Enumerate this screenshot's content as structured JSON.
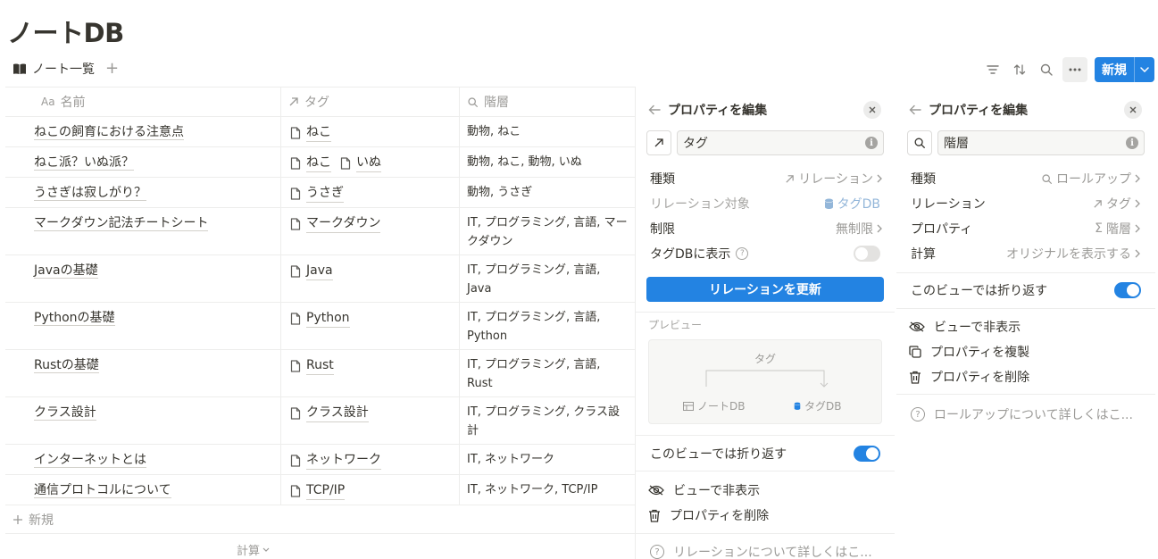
{
  "page": {
    "title": "ノートDB"
  },
  "view": {
    "tab_label": "ノート一覧",
    "add": "+"
  },
  "toolbar": {
    "new_label": "新規"
  },
  "table": {
    "headers": {
      "name": "名前",
      "name_prefix": "Aa",
      "tag": "タグ",
      "level": "階層"
    },
    "rows": [
      {
        "name": "ねこの飼育における注意点",
        "tags": [
          "ねこ"
        ],
        "level": "動物, ねこ"
      },
      {
        "name": "ねこ派？いぬ派？",
        "tags": [
          "ねこ",
          "いぬ"
        ],
        "level": "動物, ねこ, 動物, いぬ"
      },
      {
        "name": "うさぎは寂しがり？",
        "tags": [
          "うさぎ"
        ],
        "level": "動物, うさぎ"
      },
      {
        "name": "マークダウン記法チートシート",
        "tags": [
          "マークダウン"
        ],
        "level": "IT, プログラミング, 言語, マークダウン"
      },
      {
        "name": "Javaの基礎",
        "tags": [
          "Java"
        ],
        "level": "IT, プログラミング, 言語, Java"
      },
      {
        "name": "Pythonの基礎",
        "tags": [
          "Python"
        ],
        "level": "IT, プログラミング, 言語, Python"
      },
      {
        "name": "Rustの基礎",
        "tags": [
          "Rust"
        ],
        "level": "IT, プログラミング, 言語, Rust"
      },
      {
        "name": "クラス設計",
        "tags": [
          "クラス設計"
        ],
        "level": "IT, プログラミング, クラス設計"
      },
      {
        "name": "インターネットとは",
        "tags": [
          "ネットワーク"
        ],
        "level": "IT, ネットワーク"
      },
      {
        "name": "通信プロトコルについて",
        "tags": [
          "TCP/IP"
        ],
        "level": "IT, ネットワーク, TCP/IP"
      }
    ],
    "new_row": "新規",
    "calculate": "計算"
  },
  "panel1": {
    "title": "プロパティを編集",
    "name_value": "タグ",
    "type_label": "種類",
    "type_value": "リレーション",
    "target_label": "リレーション対象",
    "target_value": "タグDB",
    "limit_label": "制限",
    "limit_value": "無制限",
    "show_label": "タグDBに表示",
    "show_on": false,
    "update_button": "リレーションを更新",
    "preview_label": "プレビュー",
    "preview_tag": "タグ",
    "preview_from": "ノートDB",
    "preview_to": "タグDB",
    "wrap_label": "このビューでは折り返す",
    "wrap_on": true,
    "hide_label": "ビューで非表示",
    "delete_label": "プロパティを削除",
    "learn_label": "リレーションについて詳しくはこ..."
  },
  "panel2": {
    "title": "プロパティを編集",
    "name_value": "階層",
    "type_label": "種類",
    "type_value": "ロールアップ",
    "relation_label": "リレーション",
    "relation_value": "タグ",
    "property_label": "プロパティ",
    "property_value": "階層",
    "calc_label": "計算",
    "calc_value": "オリジナルを表示する",
    "wrap_label": "このビューでは折り返す",
    "wrap_on": true,
    "hide_label": "ビューで非表示",
    "duplicate_label": "プロパティを複製",
    "delete_label": "プロパティを削除",
    "learn_label": "ロールアップについて詳しくはこ..."
  },
  "colors": {
    "accent": "#2383e2",
    "text": "#37352f",
    "muted": "#9b9a97",
    "border": "#ededec"
  }
}
